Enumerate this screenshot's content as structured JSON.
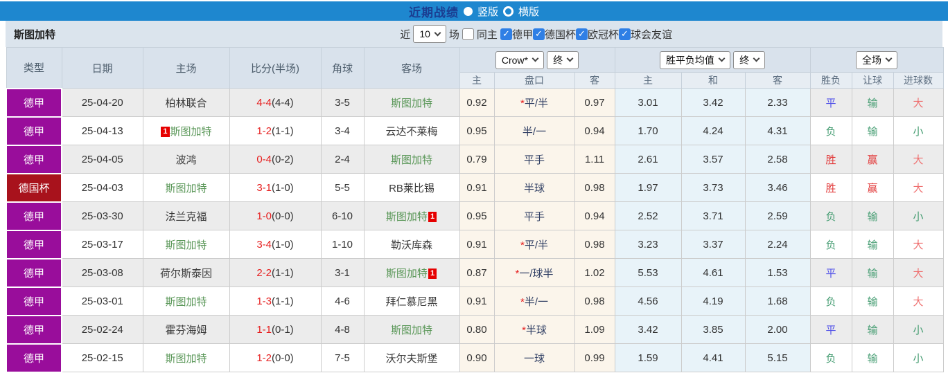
{
  "colors": {
    "topbar_blue": "#1e87cf",
    "title_navy": "#1b3d91",
    "bar_gray_blue": "#dbe4ed",
    "league_purple": "#990d9b",
    "cup_red": "#a8121c",
    "stuttgart_green": "#5a9758",
    "score_red": "#e62020",
    "win_red": "#e23b3b",
    "lose_green": "#449c71",
    "draw_blue": "#5353e8",
    "big_light_red": "#ef7070",
    "odds_cream": "#fbf5eb",
    "avg_light_blue": "#e8f3f9",
    "checkbox_blue": "#2f7fe5"
  },
  "topbar": {
    "title": "近期战绩",
    "vertical_label": "竖版",
    "horizontal_label": "横版"
  },
  "filterbar": {
    "team": "斯图加特",
    "near_label": "近",
    "count": "10",
    "games_label": "场",
    "same_home_label": "同主",
    "leagues": [
      {
        "label": "德甲"
      },
      {
        "label": "德国杯"
      },
      {
        "label": "欧冠杯"
      },
      {
        "label": "球会友谊"
      }
    ]
  },
  "table": {
    "columns": [
      "类型",
      "日期",
      "主场",
      "比分(半场)",
      "角球",
      "客场"
    ],
    "selects": {
      "company": "Crow*",
      "company_time": "终",
      "avg": "胜平负均值",
      "avg_time": "终",
      "scope": "全场"
    },
    "sub": [
      "主",
      "盘口",
      "客",
      "主",
      "和",
      "客",
      "胜负",
      "让球",
      "进球数"
    ],
    "rows": [
      {
        "type": "德甲",
        "type_class": "lg",
        "date": "25-04-20",
        "home_badge": "",
        "home": "柏林联合",
        "home_class": "opp",
        "score": "4-4",
        "half": "(4-4)",
        "corner": "3-5",
        "away": "斯图加特",
        "away_class": "stu",
        "away_badge": "",
        "odds_home": "0.92",
        "star": "*",
        "handicap": "平/半",
        "odds_away": "0.97",
        "avg_win": "3.01",
        "avg_draw": "3.42",
        "avg_lose": "2.33",
        "result": "平",
        "result_c": "blue",
        "handicap_res": "输",
        "handicap_c": "green",
        "goals": "大",
        "goals_c": "lred"
      },
      {
        "type": "德甲",
        "type_class": "lg",
        "date": "25-04-13",
        "home_badge": "1",
        "home": "斯图加特",
        "home_class": "stu",
        "score": "1-2",
        "half": "(1-1)",
        "corner": "3-4",
        "away": "云达不莱梅",
        "away_class": "opp",
        "away_badge": "",
        "odds_home": "0.95",
        "star": "",
        "handicap": "半/一",
        "odds_away": "0.94",
        "avg_win": "1.70",
        "avg_draw": "4.24",
        "avg_lose": "4.31",
        "result": "负",
        "result_c": "green",
        "handicap_res": "输",
        "handicap_c": "green",
        "goals": "小",
        "goals_c": "green"
      },
      {
        "type": "德甲",
        "type_class": "lg",
        "date": "25-04-05",
        "home_badge": "",
        "home": "波鸿",
        "home_class": "opp",
        "score": "0-4",
        "half": "(0-2)",
        "corner": "2-4",
        "away": "斯图加特",
        "away_class": "stu",
        "away_badge": "",
        "odds_home": "0.79",
        "star": "",
        "handicap": "平手",
        "odds_away": "1.11",
        "avg_win": "2.61",
        "avg_draw": "3.57",
        "avg_lose": "2.58",
        "result": "胜",
        "result_c": "red",
        "handicap_res": "赢",
        "handicap_c": "red",
        "goals": "大",
        "goals_c": "lred"
      },
      {
        "type": "德国杯",
        "type_class": "cup",
        "date": "25-04-03",
        "home_badge": "",
        "home": "斯图加特",
        "home_class": "stu",
        "score": "3-1",
        "half": "(1-0)",
        "corner": "5-5",
        "away": "RB莱比锡",
        "away_class": "opp",
        "away_badge": "",
        "odds_home": "0.91",
        "star": "",
        "handicap": "半球",
        "odds_away": "0.98",
        "avg_win": "1.97",
        "avg_draw": "3.73",
        "avg_lose": "3.46",
        "result": "胜",
        "result_c": "red",
        "handicap_res": "赢",
        "handicap_c": "red",
        "goals": "大",
        "goals_c": "lred"
      },
      {
        "type": "德甲",
        "type_class": "lg",
        "date": "25-03-30",
        "home_badge": "",
        "home": "法兰克福",
        "home_class": "opp",
        "score": "1-0",
        "half": "(0-0)",
        "corner": "6-10",
        "away": "斯图加特",
        "away_class": "stu",
        "away_badge": "1",
        "odds_home": "0.95",
        "star": "",
        "handicap": "平手",
        "odds_away": "0.94",
        "avg_win": "2.52",
        "avg_draw": "3.71",
        "avg_lose": "2.59",
        "result": "负",
        "result_c": "green",
        "handicap_res": "输",
        "handicap_c": "green",
        "goals": "小",
        "goals_c": "green"
      },
      {
        "type": "德甲",
        "type_class": "lg",
        "date": "25-03-17",
        "home_badge": "",
        "home": "斯图加特",
        "home_class": "stu",
        "score": "3-4",
        "half": "(1-0)",
        "corner": "1-10",
        "away": "勒沃库森",
        "away_class": "opp",
        "away_badge": "",
        "odds_home": "0.91",
        "star": "*",
        "handicap": "平/半",
        "odds_away": "0.98",
        "avg_win": "3.23",
        "avg_draw": "3.37",
        "avg_lose": "2.24",
        "result": "负",
        "result_c": "green",
        "handicap_res": "输",
        "handicap_c": "green",
        "goals": "大",
        "goals_c": "lred"
      },
      {
        "type": "德甲",
        "type_class": "lg",
        "date": "25-03-08",
        "home_badge": "",
        "home": "荷尔斯泰因",
        "home_class": "opp",
        "score": "2-2",
        "half": "(1-1)",
        "corner": "3-1",
        "away": "斯图加特",
        "away_class": "stu",
        "away_badge": "1",
        "odds_home": "0.87",
        "star": "*",
        "handicap": "一/球半",
        "odds_away": "1.02",
        "avg_win": "5.53",
        "avg_draw": "4.61",
        "avg_lose": "1.53",
        "result": "平",
        "result_c": "blue",
        "handicap_res": "输",
        "handicap_c": "green",
        "goals": "大",
        "goals_c": "lred"
      },
      {
        "type": "德甲",
        "type_class": "lg",
        "date": "25-03-01",
        "home_badge": "",
        "home": "斯图加特",
        "home_class": "stu",
        "score": "1-3",
        "half": "(1-1)",
        "corner": "4-6",
        "away": "拜仁慕尼黑",
        "away_class": "opp",
        "away_badge": "",
        "odds_home": "0.91",
        "star": "*",
        "handicap": "半/一",
        "odds_away": "0.98",
        "avg_win": "4.56",
        "avg_draw": "4.19",
        "avg_lose": "1.68",
        "result": "负",
        "result_c": "green",
        "handicap_res": "输",
        "handicap_c": "green",
        "goals": "大",
        "goals_c": "lred"
      },
      {
        "type": "德甲",
        "type_class": "lg",
        "date": "25-02-24",
        "home_badge": "",
        "home": "霍芬海姆",
        "home_class": "opp",
        "score": "1-1",
        "half": "(0-1)",
        "corner": "4-8",
        "away": "斯图加特",
        "away_class": "stu",
        "away_badge": "",
        "odds_home": "0.80",
        "star": "*",
        "handicap": "半球",
        "odds_away": "1.09",
        "avg_win": "3.42",
        "avg_draw": "3.85",
        "avg_lose": "2.00",
        "result": "平",
        "result_c": "blue",
        "handicap_res": "输",
        "handicap_c": "green",
        "goals": "小",
        "goals_c": "green"
      },
      {
        "type": "德甲",
        "type_class": "lg",
        "date": "25-02-15",
        "home_badge": "",
        "home": "斯图加特",
        "home_class": "stu",
        "score": "1-2",
        "half": "(0-0)",
        "corner": "7-5",
        "away": "沃尔夫斯堡",
        "away_class": "opp",
        "away_badge": "",
        "odds_home": "0.90",
        "star": "",
        "handicap": "一球",
        "odds_away": "0.99",
        "avg_win": "1.59",
        "avg_draw": "4.41",
        "avg_lose": "5.15",
        "result": "负",
        "result_c": "green",
        "handicap_res": "输",
        "handicap_c": "green",
        "goals": "小",
        "goals_c": "green"
      }
    ]
  }
}
